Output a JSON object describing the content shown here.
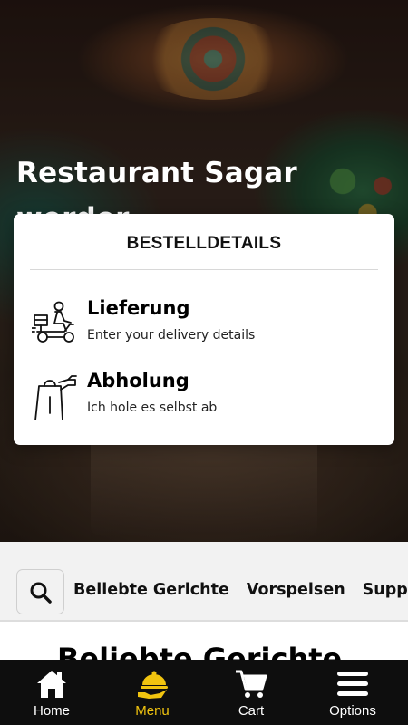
{
  "hero": {
    "title": "Restaurant Sagar werder"
  },
  "modal": {
    "title": "BESTELLDETAILS",
    "options": [
      {
        "label": "Lieferung",
        "subtitle": "Enter your delivery details",
        "icon": "delivery-scooter-icon"
      },
      {
        "label": "Abholung",
        "subtitle": "Ich hole es selbst ab",
        "icon": "takeaway-bag-icon"
      }
    ]
  },
  "categories": {
    "search_icon": "search-icon",
    "tabs": [
      "Beliebte Gerichte",
      "Vorspeisen",
      "Suppen"
    ]
  },
  "section": {
    "heading": "Beliebte Gerichte"
  },
  "bottom_nav": {
    "items": [
      {
        "label": "Home",
        "icon": "home-icon",
        "active": false
      },
      {
        "label": "Menu",
        "icon": "menu-cloche-icon",
        "active": true
      },
      {
        "label": "Cart",
        "icon": "cart-icon",
        "active": false
      },
      {
        "label": "Options",
        "icon": "hamburger-icon",
        "active": false
      }
    ],
    "active_color": "#f1c40f"
  }
}
